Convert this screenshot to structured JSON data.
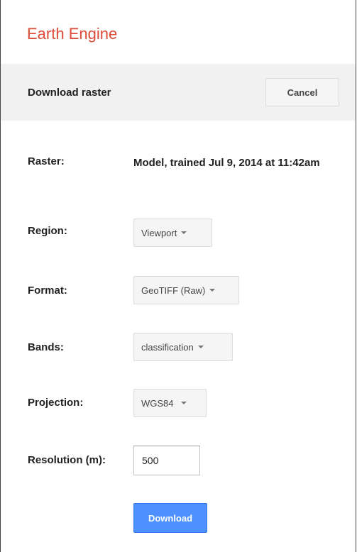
{
  "app": {
    "title": "Earth Engine"
  },
  "dialog": {
    "title": "Download raster",
    "cancel_label": "Cancel"
  },
  "fields": {
    "raster": {
      "label": "Raster:",
      "value": "Model, trained Jul 9, 2014 at 11:42am"
    },
    "region": {
      "label": "Region:",
      "value": "Viewport"
    },
    "format": {
      "label": "Format:",
      "value": "GeoTIFF (Raw)"
    },
    "bands": {
      "label": "Bands:",
      "value": "classification"
    },
    "projection": {
      "label": "Projection:",
      "value": "WGS84"
    },
    "resolution": {
      "label": "Resolution (m):",
      "value": "500"
    }
  },
  "actions": {
    "download_label": "Download"
  },
  "colors": {
    "brand": "#dd4b39",
    "header_bg": "#f1f1f1",
    "primary_button": "#4d90fe"
  },
  "icons": {
    "dropdown": "caret-down-icon"
  }
}
